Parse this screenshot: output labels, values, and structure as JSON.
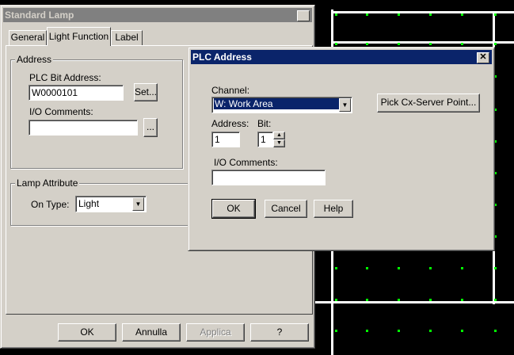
{
  "main_dialog": {
    "title": "Standard Lamp",
    "close_glyph": "✕",
    "tabs": [
      {
        "label": "General",
        "active": false
      },
      {
        "label": "Light Function",
        "active": true
      },
      {
        "label": "Label",
        "active": false
      }
    ],
    "address_group": {
      "label": "Address",
      "plc_bit_label": "PLC Bit Address:",
      "plc_bit_value": "W0000101",
      "set_button": "Set...",
      "io_comments_label": "I/O Comments:",
      "io_comments_value": "",
      "ellipsis_button": "..."
    },
    "lamp_group": {
      "label": "Lamp Attribute",
      "on_type_label": "On Type:",
      "on_type_value": "Light"
    },
    "buttons": {
      "ok": "OK",
      "cancel": "Annulla",
      "apply": "Applica",
      "help": "?"
    }
  },
  "plc_dialog": {
    "title": "PLC Address",
    "close_glyph": "✕",
    "channel_label": "Channel:",
    "channel_value": "W: Work Area",
    "pick_button": "Pick Cx-Server Point...",
    "address_label": "Address:",
    "address_value": "1",
    "bit_label": "Bit:",
    "bit_value": "1",
    "io_comments_label": "I/O Comments:",
    "io_comments_value": "",
    "ok": "OK",
    "cancel": "Cancel",
    "help": "Help"
  },
  "colors": {
    "dialog_face": "#d4d0c8",
    "title_active": "#0a246a",
    "title_inactive": "#808080",
    "canvas_bg": "#000000",
    "grid_dot": "#00ff00"
  },
  "icons": {
    "dropdown": "chevron-down-icon",
    "spin_up": "spin-up-icon",
    "spin_down": "spin-down-icon",
    "close": "close-icon"
  }
}
